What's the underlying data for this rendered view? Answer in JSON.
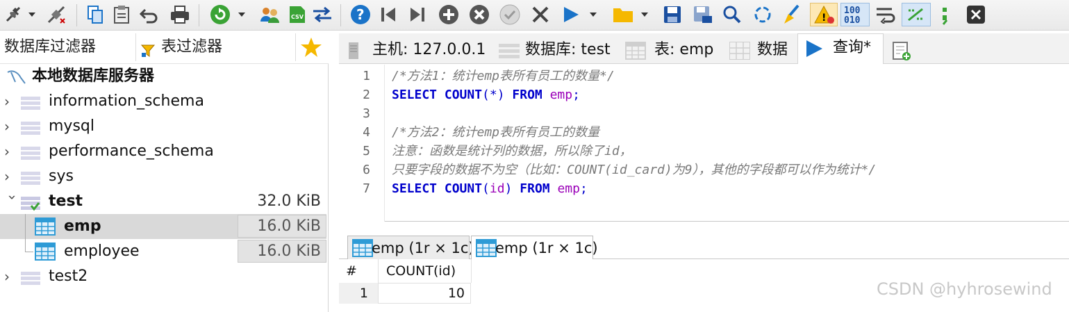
{
  "toolbar": {
    "icons": [
      "plug-icon",
      "dropdown-arrow-icon",
      "disconnect-icon",
      "copy-icon",
      "paste-icon",
      "undo-icon",
      "print-icon",
      "refresh-icon",
      "dropdown-arrow-icon",
      "user-manager-icon",
      "csv-icon",
      "transfer-icon",
      "help-icon",
      "first-icon",
      "last-icon",
      "add-icon",
      "delete-icon",
      "check-icon",
      "close-x-icon",
      "run-icon",
      "dropdown-arrow-icon",
      "folder-icon",
      "dropdown-arrow-icon",
      "save-icon",
      "save-as-icon",
      "search-icon",
      "reload-icon",
      "format-sql-icon",
      "warning-icon",
      "binary-icon",
      "wrap-icon",
      "explain-icon",
      "semicolon-icon",
      "close-tab-icon"
    ],
    "binary_label": "100\n010",
    "semicolon_label": ";"
  },
  "left_panel": {
    "db_filter_label": "数据库过滤器",
    "table_filter_label": "表过滤器",
    "root_label": "本地数据库服务器",
    "databases": [
      {
        "name": "information_schema",
        "expanded": false
      },
      {
        "name": "mysql",
        "expanded": false
      },
      {
        "name": "performance_schema",
        "expanded": false
      },
      {
        "name": "sys",
        "expanded": false
      },
      {
        "name": "test",
        "expanded": true,
        "size": "32.0 KiB"
      },
      {
        "name": "test2",
        "expanded": false
      }
    ],
    "tables": [
      {
        "name": "emp",
        "size": "16.0 KiB",
        "selected": true
      },
      {
        "name": "employee",
        "size": "16.0 KiB",
        "selected": false
      }
    ]
  },
  "tabs": [
    {
      "label": "主机: 127.0.0.1",
      "icon": "server-icon"
    },
    {
      "label": "数据库: test",
      "icon": "database-icon"
    },
    {
      "label": "表: emp",
      "icon": "table-icon"
    },
    {
      "label": "数据",
      "icon": "data-grid-icon"
    },
    {
      "label": "查询*",
      "icon": "play-icon",
      "active": true
    }
  ],
  "editor": {
    "line_numbers": [
      "1",
      "2",
      "3",
      "4",
      "5",
      "6",
      "7"
    ],
    "lines": [
      [
        {
          "t": "/*方法1：统计emp表所有员工的数量*/",
          "c": "cm"
        }
      ],
      [
        {
          "t": "SELECT ",
          "c": "kw"
        },
        {
          "t": "COUNT",
          "c": "kw"
        },
        {
          "t": "(*) ",
          "c": "pu"
        },
        {
          "t": "FROM ",
          "c": "kw"
        },
        {
          "t": "emp",
          "c": "id"
        },
        {
          "t": ";",
          "c": "pu"
        }
      ],
      [],
      [
        {
          "t": "/*方法2：统计emp表所有员工的数量",
          "c": "cm"
        }
      ],
      [
        {
          "t": "注意：函数是统计列的数据，所以除了id，",
          "c": "cm"
        }
      ],
      [
        {
          "t": "只要字段的数据不为空（比如：COUNT(id_card)为9），其他的字段都可以作为统计*/",
          "c": "cm"
        }
      ],
      [
        {
          "t": "SELECT ",
          "c": "kw"
        },
        {
          "t": "COUNT",
          "c": "kw"
        },
        {
          "t": "(",
          "c": "pu"
        },
        {
          "t": "id",
          "c": "id"
        },
        {
          "t": ") ",
          "c": "pu"
        },
        {
          "t": "FROM ",
          "c": "kw"
        },
        {
          "t": "emp",
          "c": "id"
        },
        {
          "t": ";",
          "c": "pu"
        }
      ]
    ]
  },
  "result_tabs": [
    {
      "label": "emp (1r × 1c)",
      "active": false
    },
    {
      "label": "emp (1r × 1c)",
      "active": true
    }
  ],
  "result_grid": {
    "columns": [
      "#",
      "COUNT(id)"
    ],
    "rows": [
      [
        "1",
        "10"
      ]
    ]
  },
  "watermark": "CSDN @hyhrosewind",
  "colors": {
    "keyword": "#0000cc",
    "identifier": "#9a00b8",
    "comment": "#7a7a7a",
    "accent_blue": "#1a73c8",
    "toolbar_green": "#3aa335",
    "folder_yellow": "#f5b800"
  }
}
